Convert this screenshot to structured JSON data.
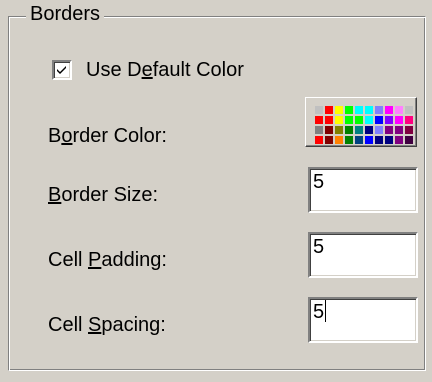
{
  "group": {
    "title": "Borders"
  },
  "use_default_color": {
    "checked": true,
    "label_pre": "Use D",
    "label_u": "e",
    "label_post": "fault Color"
  },
  "border_color": {
    "label_pre": "B",
    "label_u": "o",
    "label_post": "rder Color:",
    "palette": [
      "#c0c0c0",
      "#ff0000",
      "#ffff00",
      "#00ff00",
      "#00ffff",
      "#00ffff",
      "#8080ff",
      "#ff00ff",
      "#ff80ff",
      "#c0c0c0",
      "#ff0000",
      "#ff0000",
      "#ffff00",
      "#00ff00",
      "#00ff00",
      "#00ffff",
      "#0000ff",
      "#8000ff",
      "#ff00ff",
      "#ff0080",
      "#808080",
      "#800000",
      "#808000",
      "#008000",
      "#008080",
      "#000080",
      "#8080ff",
      "#800080",
      "#800080",
      "#800040",
      "#ff0000",
      "#800000",
      "#ff8000",
      "#008000",
      "#004080",
      "#0000ff",
      "#000080",
      "#000080",
      "#800080",
      "#400040"
    ]
  },
  "border_size": {
    "label_u": "B",
    "label_post": "order Size:",
    "value": "5"
  },
  "cell_padding": {
    "label_pre": "Cell ",
    "label_u": "P",
    "label_post": "adding:",
    "value": "5"
  },
  "cell_spacing": {
    "label_pre": "Cell ",
    "label_u": "S",
    "label_post": "pacing:",
    "value": "5"
  }
}
